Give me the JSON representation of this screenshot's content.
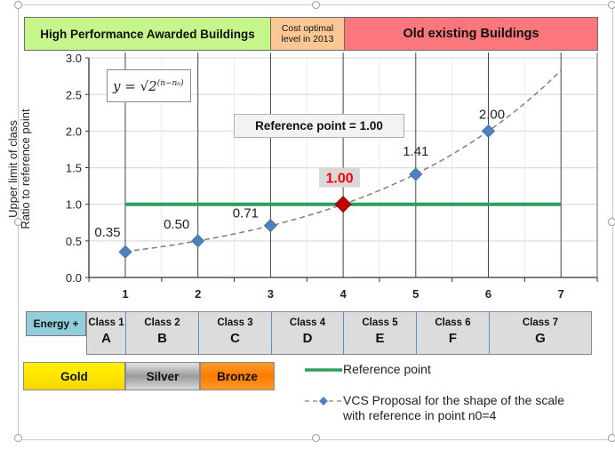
{
  "bands": {
    "high_performance": "High  Performance Awarded Buildings",
    "cost_optimal_line1": "Cost optimal",
    "cost_optimal_line2": "level  in 2013",
    "old_existing": "Old existing Buildings"
  },
  "formula": {
    "lhs": "y = √2",
    "exponent": "(n−n₀)"
  },
  "reference_box": "Reference point = 1.00",
  "energy_plus": "Energy +",
  "classes": [
    {
      "name": "Class 1",
      "letter": "A"
    },
    {
      "name": "Class 2",
      "letter": "B"
    },
    {
      "name": "Class 3",
      "letter": "C"
    },
    {
      "name": "Class 4",
      "letter": "D"
    },
    {
      "name": "Class 5",
      "letter": "E"
    },
    {
      "name": "Class 6",
      "letter": "F"
    },
    {
      "name": "Class 7",
      "letter": "G"
    }
  ],
  "medals": {
    "gold": "Gold",
    "silver": "Silver",
    "bronze": "Bronze"
  },
  "legend": {
    "reference": "Reference point",
    "proposal_line1": "VCS Proposal for the shape of the scale",
    "proposal_line2": "with reference in point n0=4"
  },
  "colors": {
    "reference_line": "#2e9e5b",
    "marker": "#4f81bd",
    "reference_marker": "#c00000",
    "reference_label": "#ff0000",
    "band_green": "#c6f58c",
    "band_orange": "#fbc895",
    "band_red": "#fb777c",
    "energy_plus": "#92cddc"
  },
  "chart_data": {
    "type": "line",
    "title": "",
    "xlabel": "",
    "ylabel": "Upper limit of class\nRatio to reference point",
    "xlim": [
      0.5,
      7.5
    ],
    "ylim": [
      0,
      3.0
    ],
    "x_ticks": [
      1,
      2,
      3,
      4,
      5,
      6,
      7
    ],
    "y_ticks": [
      "0.0",
      "0.5",
      "1.0",
      "1.5",
      "2.0",
      "2.5",
      "3.0"
    ],
    "grid": true,
    "series": [
      {
        "name": "VCS Proposal for the shape of the scale with reference in point n0=4",
        "style": "dashed with diamond markers",
        "x": [
          1,
          2,
          3,
          4,
          5,
          6
        ],
        "values": [
          0.35,
          0.5,
          0.71,
          1.0,
          1.41,
          2.0
        ],
        "labels": [
          "0.35",
          "0.50",
          "0.71",
          "1.00",
          "1.41",
          "2.00"
        ],
        "curve_extends_to": {
          "x": 7,
          "y": 2.83
        }
      },
      {
        "name": "Reference point",
        "style": "solid",
        "x": [
          1,
          7
        ],
        "values": [
          1.0,
          1.0
        ]
      }
    ],
    "highlight_point": {
      "x": 4,
      "y": 1.0,
      "label": "1.00"
    },
    "legend_position": "bottom-right"
  }
}
